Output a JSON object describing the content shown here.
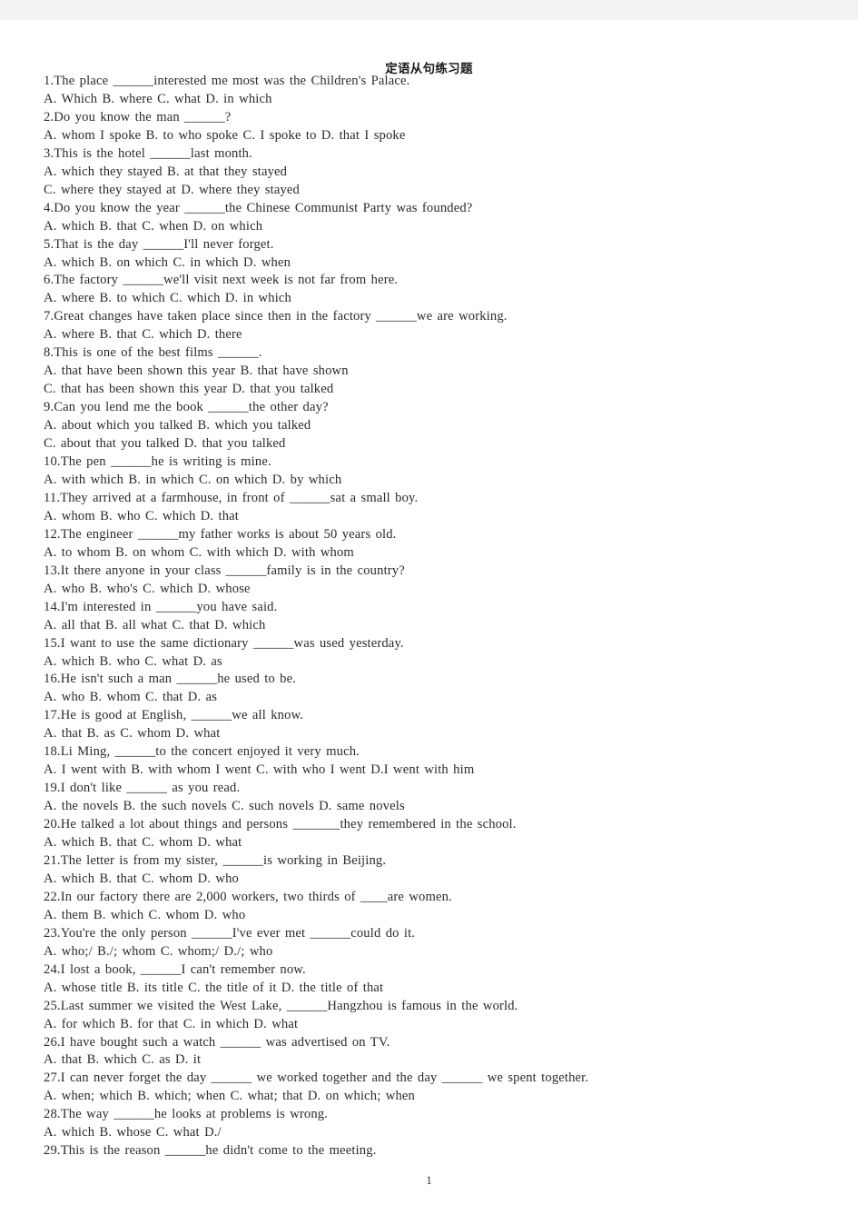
{
  "document": {
    "title": "定语从句练习题",
    "page_number": "1",
    "lines": [
      "1.The place ______interested me most was the Children's Palace.",
      "A. Which        B. where      C. what            D. in which",
      "2.Do you know the man ______?",
      "A. whom I spoke    B. to who spoke    C. I spoke to    D. that I spoke",
      "3.This is the hotel ______last month.",
      "A. which they stayed          B. at that they stayed",
      "C. where they stayed at      D. where they stayed",
      "4.Do you know the year ______the Chinese Communist Party was founded?",
      "A. which     B. that     C. when      D. on which",
      "5.That is the day ______I'll never forget.",
      "A. which     B. on which    C. in which    D. when",
      "6.The factory ______we'll visit next week is not far from here.",
      "A. where      B. to which    C. which     D. in which",
      "7.Great changes have taken place since then in the factory ______we are working.",
      "A. where      B. that     C. which     D. there",
      "8.This is one of the best films ______.",
      "A. that have been shown this year      B. that have shown",
      "C. that has been shown this year        D. that you talked",
      "9.Can you lend me the book ______the other day?",
      "A. about which you talked      B. which you talked",
      "C. about that you talked       D. that you talked",
      "10.The pen ______he is writing is mine.",
      "A. with which     B. in which     C. on which     D. by which",
      "11.They arrived at a farmhouse, in front of ______sat a small boy.",
      "A. whom      B. who     C. which      D. that",
      "12.The engineer ______my father works is about 50 years old.",
      "A. to whom     B. on whom     C. with which     D. with whom",
      "13.It there anyone in your class ______family is in the country?",
      "A. who      B. who's      C. which      D. whose",
      "14.I'm interested in ______you have said.",
      "A. all that     B. all what     C. that      D. which",
      "15.I want to use the same dictionary ______was used yesterday.",
      "A. which      B. who      C. what      D. as",
      "16.He isn't such a man ______he used to be.",
      "A. who      B. whom      C. that      D. as",
      "17.He is good at English, ______we all know.",
      "A. that      B. as      C. whom      D. what",
      "18.Li Ming, ______to the concert enjoyed it very much.",
      "A. I went with    B. with whom I went    C. with who I went    D.I went with him",
      "19.I don't like ______ as you read.",
      "A. the novels      B. the such novels      C. such novels      D. same novels",
      "20.He talked a lot about things and persons _______they remembered in the school.",
      "A. which      B. that      C. whom      D. what",
      "21.The letter is from my sister, ______is working in Beijing.",
      "A. which      B. that      C. whom      D. who",
      "22.In our factory there are 2,000 workers, two thirds of ____are women.",
      "A. them      B. which      C. whom      D. who",
      "23.You're the only person ______I've ever met ______could do it.",
      "A. who;/      B./; whom      C. whom;/      D./; who",
      "24.I lost a book, ______I can't remember now.",
      "A. whose title     B. its title     C. the title of it    D. the title of that",
      "25.Last summer we visited the West Lake, ______Hangzhou is famous in the world.",
      "A. for which      B. for that      C. in which      D. what",
      "26.I have bought such a watch ______ was advertised on TV.",
      "A. that     B. which      C. as      D. it",
      "27.I can never forget the day ______ we worked together and the day ______ we spent together.",
      "A. when; which      B. which; when      C. what; that      D. on which; when",
      "28.The way ______he looks at problems is wrong.",
      "A. which      B. whose      C. what      D./",
      "29.This is the reason ______he didn't come to the meeting."
    ]
  }
}
